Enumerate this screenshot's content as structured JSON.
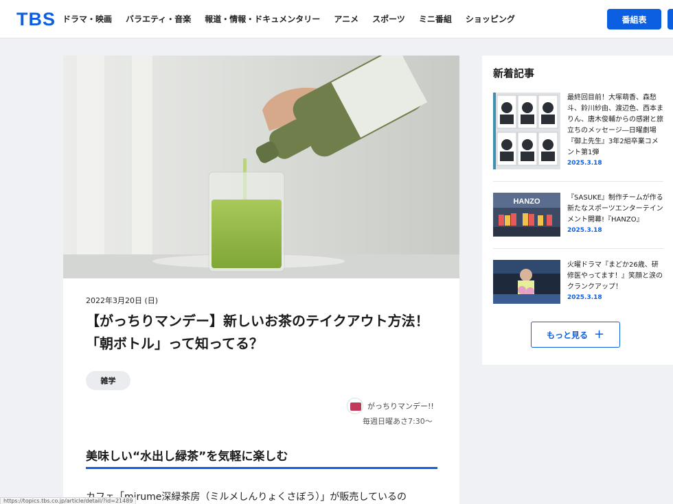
{
  "header": {
    "logo": "TBS",
    "nav": [
      "ドラマ・映画",
      "バラエティ・音楽",
      "報道・情報・ドキュメンタリー",
      "アニメ",
      "スポーツ",
      "ミニ番組",
      "ショッピング"
    ],
    "guide_button": "番組表"
  },
  "article": {
    "hero_icon": "green-tea-bottle-photo",
    "date": "2022年3月20日 (日)",
    "title": "【がっちりマンデー】新しいお茶のテイクアウト方法！「朝ボトル」って知ってる？",
    "tag": "雑学",
    "program": {
      "name": "がっちりマンデー!!",
      "time": "毎週日曜あさ7:30〜"
    },
    "section_heading": "美味しい“水出し緑茶”を気軽に楽しむ",
    "body_first_line": "カフェ「mirume深緑茶房（ミルメしんりょくさぼう）」が販売しているの"
  },
  "sidebar": {
    "heading": "新着記事",
    "items": [
      {
        "title": "最終回目前！大塚萌香、森愁斗、鈴川紗由、渡辺色、西本まりん、唐木俊輔からの感謝と旅立ちのメッセージ―日曜劇場『御上先生』3年2組卒業コメント第1弾",
        "date": "2025.3.18"
      },
      {
        "title": "『SASUKE』制作チームが作る新たなスポーツエンターテインメント開幕!『HANZO』",
        "date": "2025.3.18"
      },
      {
        "title": "火曜ドラマ『まどか26歳、研修医やってます！』笑顔と涙のクランクアップ！",
        "date": "2025.3.18"
      }
    ],
    "more_label": "もっと見る"
  },
  "status_url": "https://topics.tbs.co.jp/article/detail/?id=21489",
  "colors": {
    "accent": "#0b5fe0",
    "background": "#f0f1f4"
  }
}
